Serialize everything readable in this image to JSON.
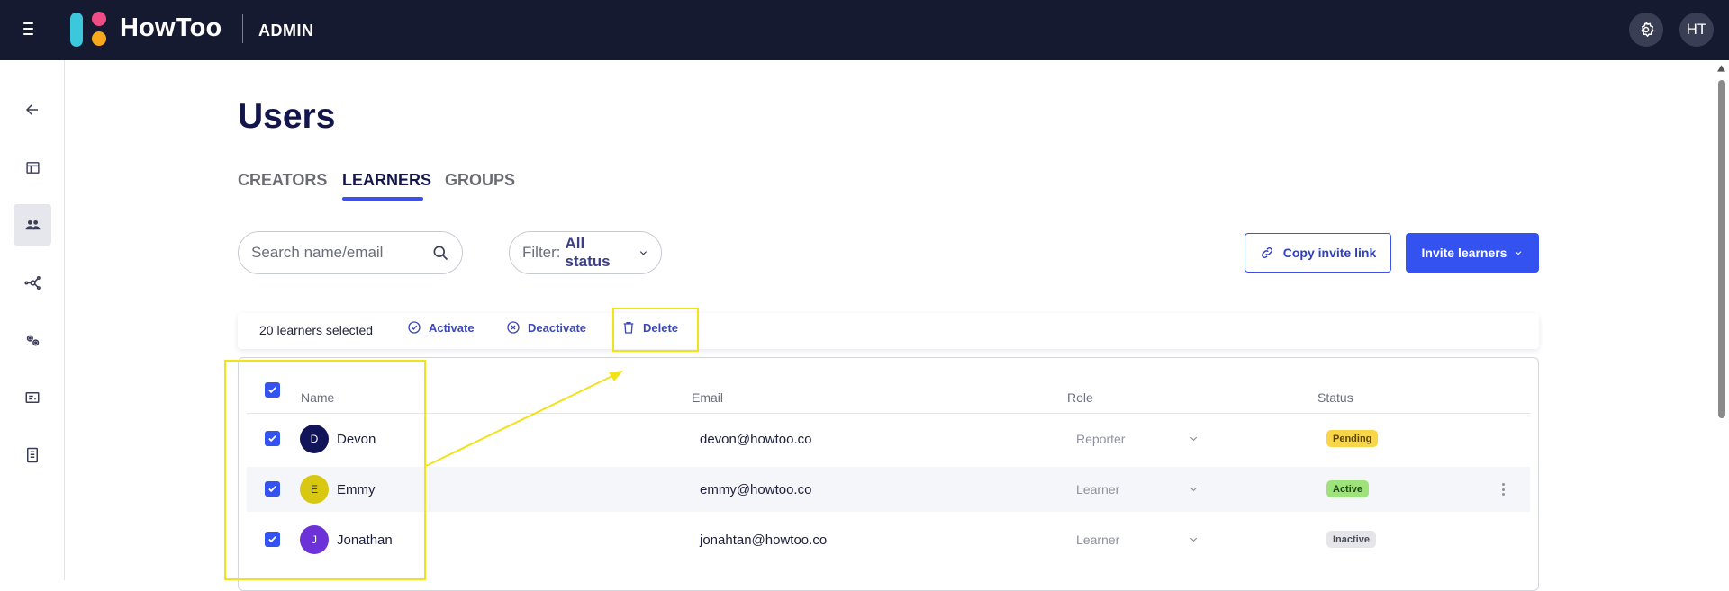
{
  "topbar": {
    "brand": "HowToo",
    "section": "ADMIN",
    "user_initials": "HT",
    "icons": [
      "hamburger-icon",
      "howtoo-logo",
      "gear-icon"
    ]
  },
  "rail": {
    "items": [
      {
        "icon": "arrow-left-icon",
        "active": false
      },
      {
        "icon": "layout-icon",
        "active": false
      },
      {
        "icon": "users-icon",
        "active": true
      },
      {
        "icon": "network-icon",
        "active": false
      },
      {
        "icon": "gears-icon",
        "active": false
      },
      {
        "icon": "id-card-icon",
        "active": false
      },
      {
        "icon": "document-icon",
        "active": false
      }
    ]
  },
  "page": {
    "title": "Users",
    "tabs": [
      {
        "label": "CREATORS",
        "active": false
      },
      {
        "label": "LEARNERS",
        "active": true
      },
      {
        "label": "GROUPS",
        "active": false
      }
    ]
  },
  "toolbar": {
    "search_placeholder": "Search name/email",
    "filter_prefix": "Filter:",
    "filter_value": "All status",
    "copy_link_label": "Copy invite link",
    "invite_label": "Invite learners"
  },
  "bulk": {
    "count_label": "20 learners selected",
    "activate": "Activate",
    "deactivate": "Deactivate",
    "delete": "Delete"
  },
  "table": {
    "headers": {
      "name": "Name",
      "email": "Email",
      "role": "Role",
      "status": "Status"
    },
    "rows": [
      {
        "initial": "D",
        "name": "Devon",
        "email": "devon@howtoo.co",
        "role": "Reporter",
        "status": "Pending",
        "avatar_color": "#12145a"
      },
      {
        "initial": "E",
        "name": "Emmy",
        "email": "emmy@howtoo.co",
        "role": "Learner",
        "status": "Active",
        "avatar_color": "#d8c812"
      },
      {
        "initial": "J",
        "name": "Jonathan",
        "email": "jonahtan@howtoo.co",
        "role": "Learner",
        "status": "Inactive",
        "avatar_color": "#6c32d8"
      }
    ]
  },
  "colors": {
    "topbar_bg": "#161a30",
    "accent": "#3352f0",
    "pending": "#f8d64a",
    "active": "#9ee27b",
    "inactive": "#e6e6ea",
    "annotation": "#f2e21c"
  }
}
